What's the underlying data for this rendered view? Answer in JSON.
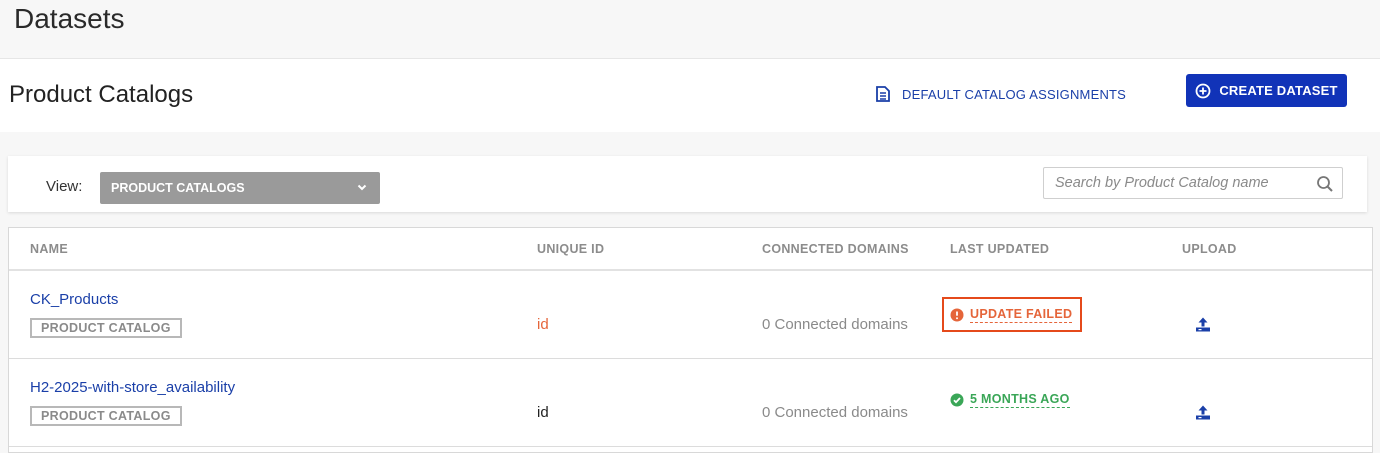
{
  "page": {
    "title": "Datasets"
  },
  "section": {
    "title": "Product Catalogs",
    "default_assignments_label": "DEFAULT CATALOG ASSIGNMENTS",
    "create_label": "CREATE DATASET"
  },
  "filter": {
    "view_label": "View:",
    "view_value": "PRODUCT CATALOGS",
    "search_placeholder": "Search by Product Catalog name"
  },
  "table": {
    "columns": [
      "NAME",
      "UNIQUE ID",
      "CONNECTED DOMAINS",
      "LAST UPDATED",
      "UPLOAD"
    ],
    "rows": [
      {
        "name": "CK_Products",
        "tag": "PRODUCT CATALOG",
        "unique_id": "id",
        "connected_domains": "0 Connected domains",
        "last_updated": "UPDATE FAILED",
        "status": "failed"
      },
      {
        "name": "H2-2025-with-store_availability",
        "tag": "PRODUCT CATALOG",
        "unique_id": "id",
        "connected_domains": "0 Connected domains",
        "last_updated": "5 MONTHS AGO",
        "status": "ok"
      }
    ]
  },
  "colors": {
    "primary": "#1133b8",
    "link": "#1a3fa8",
    "error": "#e54a1b",
    "success": "#3aa657",
    "id_error": "#e5653a"
  },
  "icons": {
    "assignments": "document-list-icon",
    "create": "plus-circle-icon",
    "dropdown": "chevron-down-icon",
    "search": "search-icon",
    "failed": "error-circle-icon",
    "ok": "check-circle-icon",
    "upload": "upload-icon"
  }
}
